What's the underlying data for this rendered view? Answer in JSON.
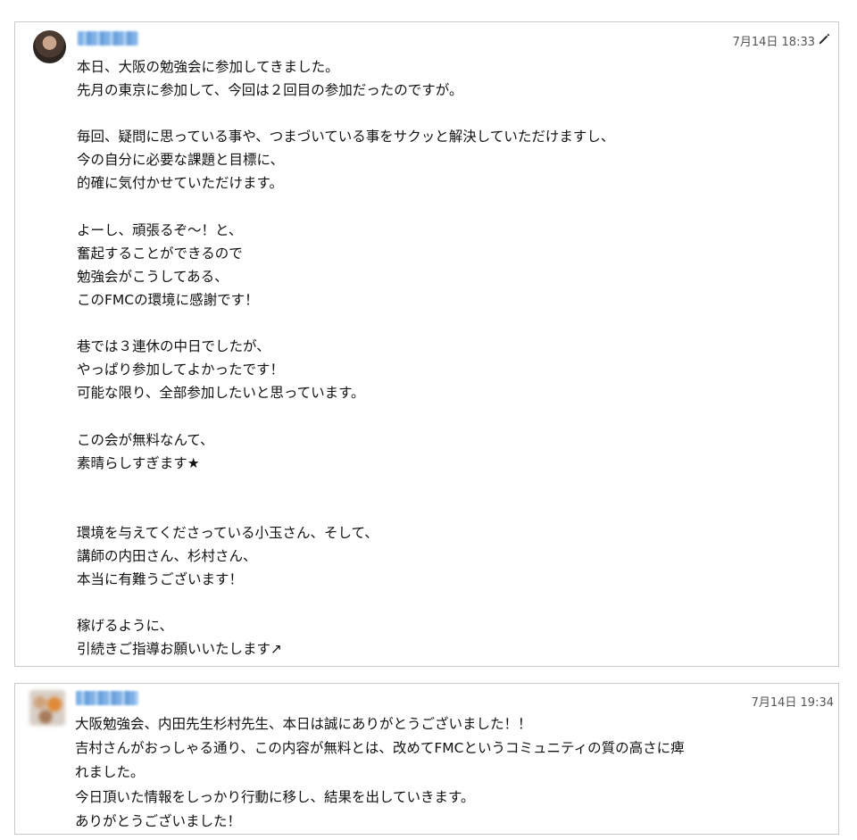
{
  "messages": [
    {
      "timestamp": "7月14日 18:33",
      "edited_icon": "pencil-icon",
      "text": "本日、大阪の勉強会に参加してきました。\n先月の東京に参加して、今回は２回目の参加だったのですが。\n\n毎回、疑問に思っている事や、つまづいている事をサクッと解決していただけますし、\n今の自分に必要な課題と目標に、\n的確に気付かせていただけます。\n\nよーし、頑張るぞ〜！と、\n奮起することができるので\n勉強会がこうしてある、\nこのFMCの環境に感謝です！\n\n巷では３連休の中日でしたが、\nやっぱり参加してよかったです！\n可能な限り、全部参加したいと思っています。\n\nこの会が無料なんて、\n素晴らしすぎます★\n\n\n環境を与えてくださっている小玉さん、そして、\n講師の内田さん、杉村さん、\n本当に有難うございます！\n\n稼げるように、\n引続きご指導お願いいたします↗"
    },
    {
      "timestamp": "7月14日 19:34",
      "text": "大阪勉強会、内田先生杉村先生、本日は誠にありがとうございました！！\n吉村さんがおっしゃる通り、この内容が無料とは、改めてFMCというコミュニティの質の高さに痺\nれました。\n今日頂いた情報をしっかり行動に移し、結果を出していきます。\nありがとうございました！"
    }
  ]
}
